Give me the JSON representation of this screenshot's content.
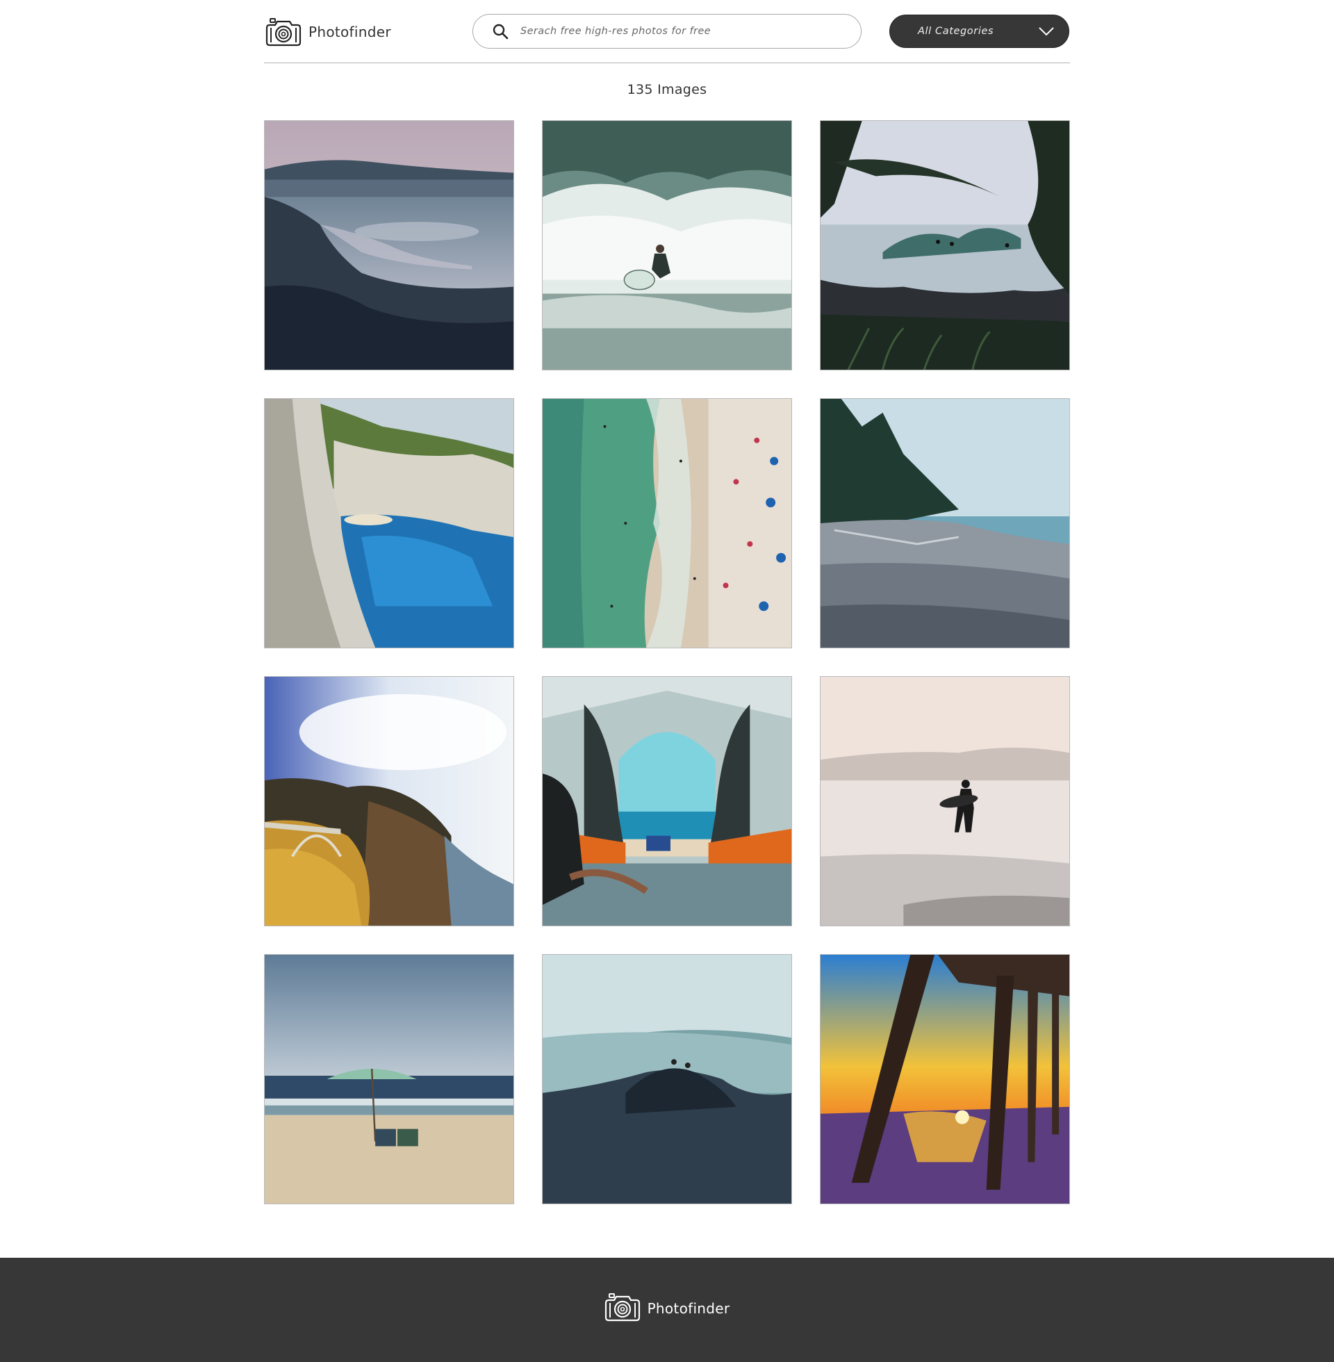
{
  "header": {
    "brand": "Photofinder",
    "search": {
      "placeholder": "Serach free high-res photos for free",
      "value": ""
    },
    "category_select": {
      "selected": "All Categories"
    }
  },
  "results": {
    "count_label": "135 Images"
  },
  "gallery": {
    "images": [
      {
        "subject": "rocky shore with calm water at dusk"
      },
      {
        "subject": "surfer riding a breaking wave"
      },
      {
        "subject": "surfers seen through palm leaves over rocky coast"
      },
      {
        "subject": "turquoise cove between white cliffs with shipwreck beach"
      },
      {
        "subject": "aerial view of crowded beach and green sea"
      },
      {
        "subject": "pebble beach with pine trees"
      },
      {
        "subject": "coastal arch bridge along cliffs"
      },
      {
        "subject": "view of beach from inside a tent"
      },
      {
        "subject": "surfer silhouette carrying a board on misty beach"
      },
      {
        "subject": "beach umbrella with two chairs by the sea"
      },
      {
        "subject": "people standing on dark rocks above waves"
      },
      {
        "subject": "sunset beneath a pier"
      }
    ]
  },
  "footer": {
    "brand": "Photofinder"
  },
  "colors": {
    "dark": "#373737",
    "border": "#b5b5b5",
    "text": "#333333"
  },
  "icons": {
    "logo": "camera-icon",
    "search": "search-icon",
    "dropdown": "chevron-down-icon"
  }
}
